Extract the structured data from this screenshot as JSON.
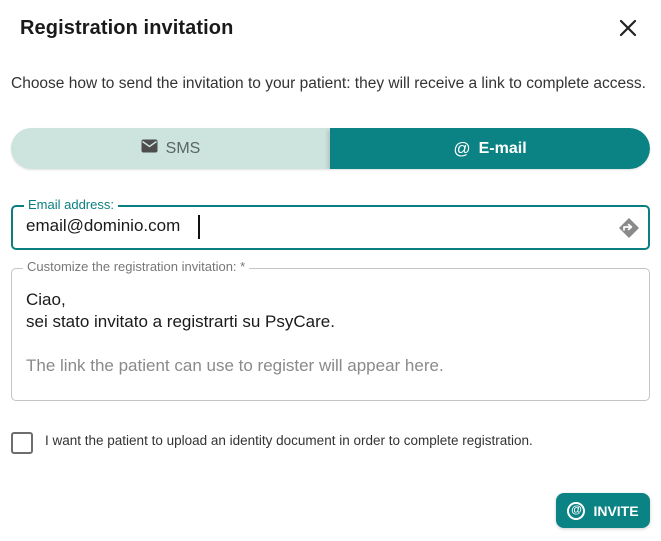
{
  "dialog": {
    "title": "Registration invitation",
    "description": "Choose how to send the invitation to your patient: they will receive a link to complete access."
  },
  "tabs": [
    {
      "label": "SMS",
      "icon": "envelope-icon",
      "selected": false
    },
    {
      "label": "E-mail",
      "icon": "at-icon",
      "selected": true
    }
  ],
  "email_field": {
    "label": "Email address:",
    "value": "email@dominio.com"
  },
  "custom_field": {
    "label": "Customize the registration invitation: *",
    "line1": "Ciao,",
    "line2": "sei stato invitato a registrarti su PsyCare.",
    "hint": "The link the patient can use to register will appear here."
  },
  "checkbox": {
    "label": "I want the patient to upload an identity document in order to complete registration.",
    "checked": false
  },
  "invite_button": {
    "label": "INVITE",
    "icon": "at-icon"
  },
  "colors": {
    "accent": "#0b8283",
    "tab_bg": "#cde3de"
  }
}
